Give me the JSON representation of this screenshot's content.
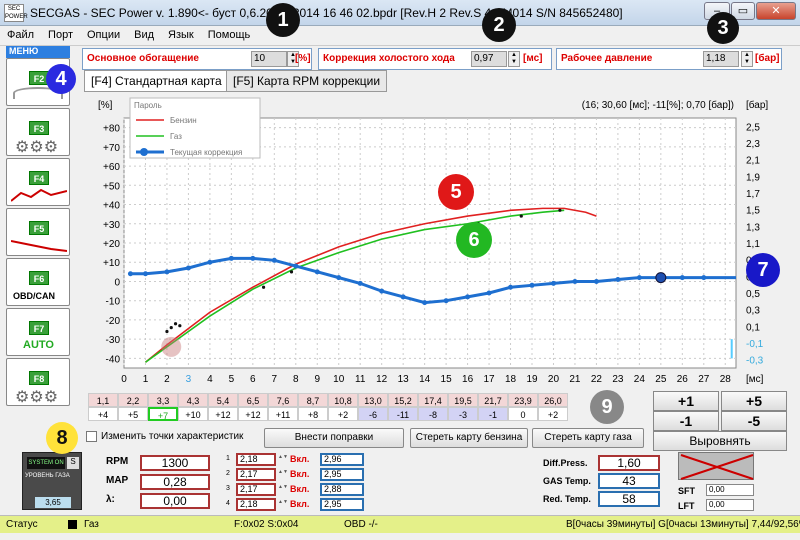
{
  "window": {
    "title": "SECGAS - SEC Power v. 1.890<- буст 0,6.20 08 2014 16 46 02.bpdr [Rev.H 2 Rev.S 4 SM014  S/N 845652480]",
    "logo": "SEC POWER",
    "min": "–",
    "max": "▭",
    "close": "✕"
  },
  "menu": [
    "Файл",
    "Порт",
    "Опции",
    "Вид",
    "Язык",
    "Помощь"
  ],
  "params": [
    {
      "label": "Основное обогащение",
      "value": "10",
      "unit": "[%]"
    },
    {
      "label": "Коррекция холостого хода",
      "value": "0,97",
      "unit": "[мс]"
    },
    {
      "label": "Рабочее давление",
      "value": "1,18",
      "unit": "[бар]"
    }
  ],
  "sidebar": {
    "header": "МЕНЮ",
    "keys": [
      "F2",
      "F3",
      "F4",
      "F5",
      "F6",
      "F7",
      "F8"
    ],
    "f6_label": "OBD/CAN",
    "f7_label": "AUTO"
  },
  "tabs": [
    "[F4] Стандартная карта",
    "[F5] Карта RPM коррекции"
  ],
  "badges": [
    "1",
    "2",
    "3",
    "4",
    "5",
    "6",
    "7",
    "8",
    "9"
  ],
  "chart": {
    "left_unit": "[%]",
    "right_unit": "[бар]",
    "x_unit": "[мс]",
    "info": "(16; 30,60 [мс]; -11[%]; 0,70 [бар])",
    "legend": {
      "title": "Пароль",
      "items": [
        "Бензин",
        "Газ",
        "Текущая коррекция"
      ]
    },
    "y_ticks": [
      "+80",
      "+70",
      "+60",
      "+50",
      "+40",
      "+30",
      "+20",
      "+10",
      "0",
      "-10",
      "-20",
      "-30",
      "-40"
    ],
    "right_ticks": [
      "2,5",
      "2,3",
      "2,1",
      "1,9",
      "1,7",
      "1,5",
      "1,3",
      "1,1",
      "0,9",
      "0,7",
      "0,5",
      "0,3",
      "0,1"
    ],
    "x_ticks": [
      "0",
      "1",
      "2",
      "3",
      "4",
      "5",
      "6",
      "7",
      "8",
      "9",
      "10",
      "11",
      "12",
      "13",
      "14",
      "15",
      "16",
      "17",
      "18",
      "19",
      "20",
      "21",
      "22",
      "23",
      "24",
      "25",
      "26",
      "27",
      "28"
    ],
    "right_extra": [
      "-0,1",
      "-0,3"
    ]
  },
  "chart_data": {
    "type": "line",
    "xlabel": "[мс]",
    "ylabel": "[%]",
    "y2label": "[бар]",
    "xlim": [
      0,
      28.5
    ],
    "ylim": [
      -45,
      85
    ],
    "y2lim": [
      -0.4,
      2.6
    ],
    "grid": true,
    "legend": "top-left",
    "series": [
      {
        "name": "Бензин",
        "color": "#e02020",
        "x": [
          1,
          2,
          4,
          6,
          8,
          10,
          12,
          14,
          16,
          18,
          19.5,
          20.5,
          21.5,
          22
        ],
        "y": [
          -42,
          -33,
          -16,
          -3,
          9,
          18,
          25,
          30,
          34,
          37,
          38,
          38,
          36,
          34
        ]
      },
      {
        "name": "Газ",
        "color": "#20c020",
        "x": [
          1,
          2,
          4,
          6,
          8,
          10,
          12,
          14,
          16,
          18,
          19.5,
          20.5
        ],
        "y": [
          -42,
          -34,
          -18,
          -4,
          7,
          15,
          22,
          27,
          30,
          34,
          36,
          37
        ]
      },
      {
        "name": "Текущая коррекция",
        "color": "#1e6fd0",
        "x": [
          0.3,
          1,
          2,
          3,
          4,
          5,
          6,
          7,
          8,
          9,
          10,
          11,
          12,
          13,
          14,
          15,
          16,
          17,
          18,
          19,
          20,
          21,
          22,
          23,
          24,
          25,
          26,
          27,
          28.5
        ],
        "y": [
          4,
          4,
          5,
          7,
          10,
          12,
          12,
          11,
          8,
          5,
          2,
          -1,
          -5,
          -8,
          -11,
          -10,
          -8,
          -6,
          -3,
          -2,
          -1,
          0,
          0,
          1,
          2,
          2,
          2,
          2,
          2
        ]
      }
    ]
  },
  "table": {
    "top": [
      "1,1",
      "2,2",
      "3,3",
      "4,3",
      "5,4",
      "6,5",
      "7,6",
      "8,7",
      "10,8",
      "13,0",
      "15,2",
      "17,4",
      "19,5",
      "21,7",
      "23,9",
      "26,0"
    ],
    "bottom": [
      "+4",
      "+5",
      "+7",
      "+10",
      "+12",
      "+12",
      "+11",
      "+8",
      "+2",
      "-6",
      "-11",
      "-8",
      "-3",
      "-1",
      "0",
      "+2"
    ]
  },
  "step_buttons": [
    "+1",
    "+5",
    "-1",
    "-5",
    "Выровнять"
  ],
  "actions": {
    "checkbox": "Изменить точки характеристик",
    "apply": "Внести поправки",
    "erase_petrol": "Стереть карту бензина",
    "erase_gas": "Стереть карту газа"
  },
  "gauges": [
    {
      "label": "RPM",
      "value": "1300"
    },
    {
      "label": "MAP",
      "value": "0,28"
    },
    {
      "label": "λ:",
      "value": "0,00"
    }
  ],
  "injectors": [
    {
      "n": "1",
      "ms": "2,18",
      "state": "Вкл.",
      "gas": "2,96"
    },
    {
      "n": "2",
      "ms": "2,17",
      "state": "Вкл.",
      "gas": "2,95"
    },
    {
      "n": "3",
      "ms": "2,17",
      "state": "Вкл.",
      "gas": "2,88"
    },
    {
      "n": "4",
      "ms": "2,18",
      "state": "Вкл.",
      "gas": "2,95"
    }
  ],
  "sensors": [
    {
      "label": "Diff.Press.",
      "value": "1,60"
    },
    {
      "label": "GAS Temp.",
      "value": "43"
    },
    {
      "label": "Red. Temp.",
      "value": "58"
    }
  ],
  "trims": [
    {
      "label": "SFT",
      "value": "0,00"
    },
    {
      "label": "LFT",
      "value": "0,00"
    }
  ],
  "switch": {
    "system": "SYSTEM ON",
    "level": "УРОВЕНЬ ГАЗА",
    "level_value": "3,65",
    "s": "S"
  },
  "status": {
    "label": "Статус",
    "fuel": "Газ",
    "codes": "F:0x02 S:0x04",
    "obd": "OBD -/-",
    "time": "В[0часы 39минуты] G[0часы 13минуты] 7,44/92,56%"
  }
}
